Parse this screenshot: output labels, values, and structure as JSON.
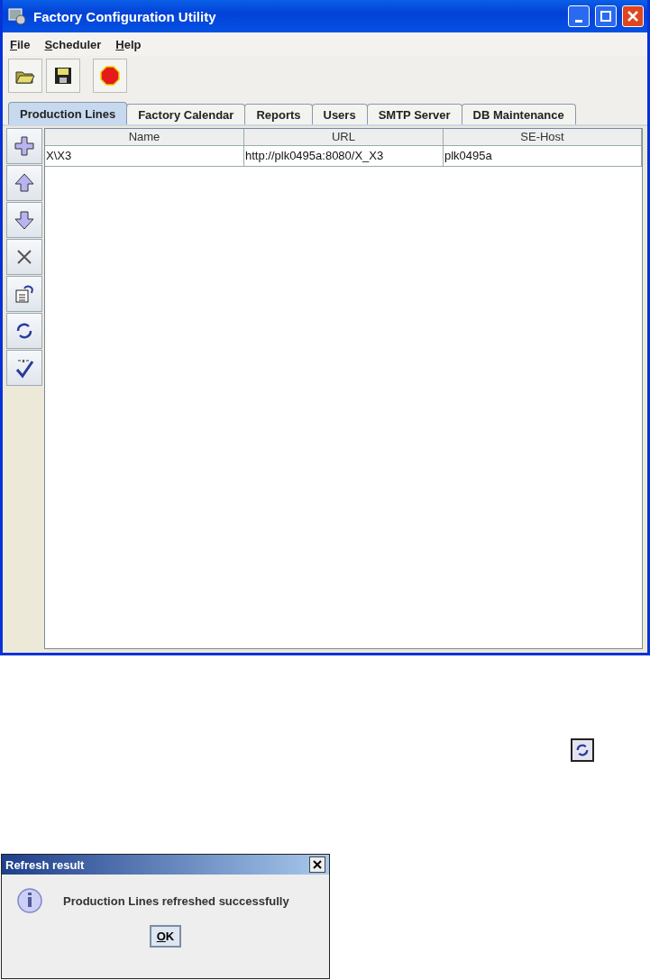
{
  "window": {
    "title": "Factory Configuration Utility"
  },
  "menu": [
    "File",
    "Scheduler",
    "Help"
  ],
  "tabs": [
    {
      "label": "Production Lines",
      "selected": true
    },
    {
      "label": "Factory Calendar",
      "selected": false
    },
    {
      "label": "Reports",
      "selected": false
    },
    {
      "label": "Users",
      "selected": false
    },
    {
      "label": "SMTP Server",
      "selected": false
    },
    {
      "label": "DB Maintenance",
      "selected": false
    }
  ],
  "table": {
    "columns": [
      "Name",
      "URL",
      "SE-Host"
    ],
    "rows": [
      [
        "X\\X3",
        "http://plk0495a:8080/X_X3",
        "plk0495a"
      ]
    ]
  },
  "dialog": {
    "title": "Refresh result",
    "message": "Production Lines refreshed successfully",
    "button": "OK"
  }
}
